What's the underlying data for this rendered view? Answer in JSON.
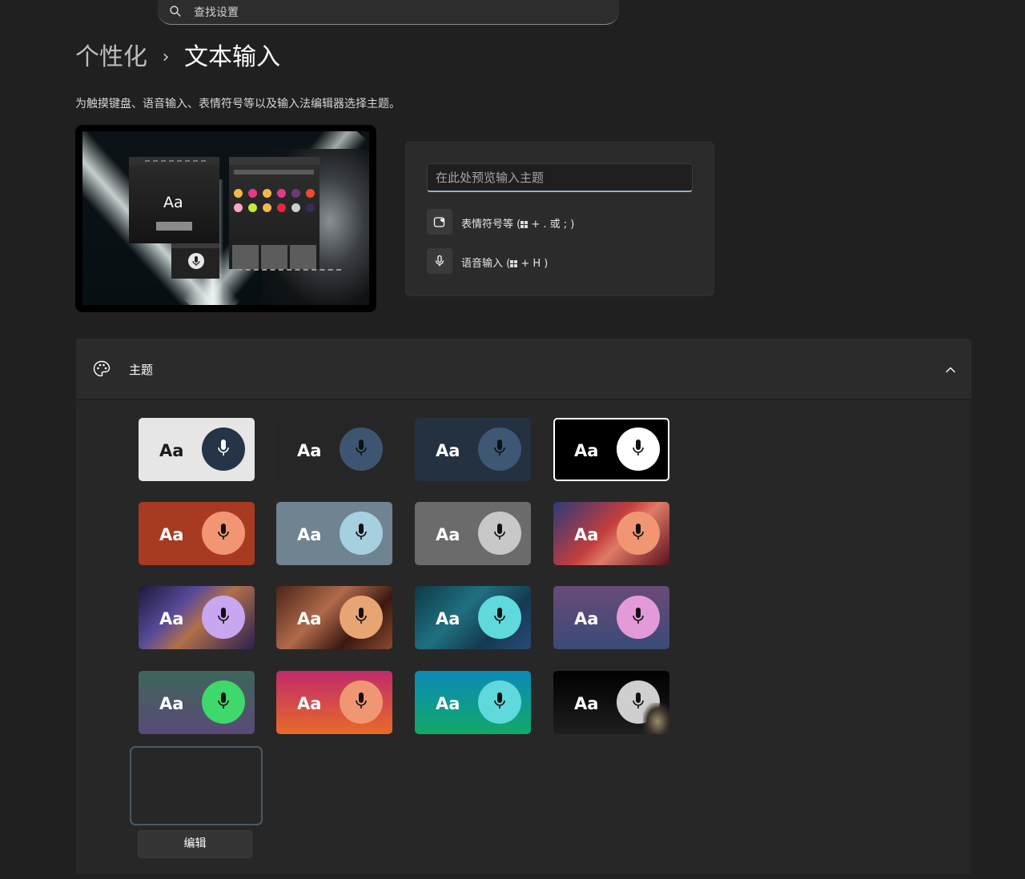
{
  "search": {
    "placeholder": "查找设置",
    "icon": "search-icon"
  },
  "breadcrumb": {
    "parent": "个性化",
    "separator": "›",
    "current": "文本输入"
  },
  "description": "为触摸键盘、语音输入、表情符号等以及输入法编辑器选择主题。",
  "tablet_preview": {
    "sample_text": "Aa"
  },
  "preview_box": {
    "input_placeholder": "在此处预览输入主题",
    "emoji_label_pre": "表情符号等 (",
    "emoji_label_post": " + . 或 ; )",
    "voice_label_pre": "语音输入 (",
    "voice_label_post": " + H )",
    "emoji_icon": "emoji-heart-icon",
    "voice_icon": "microphone-icon"
  },
  "themes": {
    "title": "主题",
    "icon": "palette-icon",
    "expanded": true,
    "tile_text": "Aa",
    "items": [
      {
        "bg": "#e6e6e6",
        "text": "#1a1a1a",
        "circle": "#253447",
        "mic": "#ffffff"
      },
      {
        "bg": "#262626",
        "text": "#ffffff",
        "circle": "#3e5572",
        "mic": "#111111"
      },
      {
        "bg": "#243140",
        "text": "#ffffff",
        "circle": "#3d5774",
        "mic": "#111111"
      },
      {
        "bg": "#000000",
        "text": "#ffffff",
        "circle": "#ffffff",
        "mic": "#111111",
        "border": "#ffffff"
      },
      {
        "bg": "#a83a22",
        "text": "#ffffff",
        "circle": "#f09673",
        "mic": "#111111"
      },
      {
        "bg": "#6f8390",
        "text": "#ffffff",
        "circle": "#a6cfe0",
        "mic": "#111111"
      },
      {
        "bg": "#6b6b6b",
        "text": "#ffffff",
        "circle": "#c8c8c8",
        "mic": "#111111"
      },
      {
        "bg": "linear-gradient(135deg,#2a3c7a 0%,#c33d3d 45%,#e07b66 60%,#5a1020 100%)",
        "text": "#ffffff",
        "circle": "#f09673",
        "mic": "#111111"
      },
      {
        "bg": "linear-gradient(135deg,#1a1a3a 0%,#5a4a9a 35%,#b0704a 55%,#2a2050 100%)",
        "text": "#ffffff",
        "circle": "#c9a6f0",
        "mic": "#111111"
      },
      {
        "bg": "linear-gradient(135deg,#4a2418 0%,#b06a4a 40%,#3a1810 70%,#8a4a30 100%)",
        "text": "#ffffff",
        "circle": "#e8a574",
        "mic": "#111111"
      },
      {
        "bg": "linear-gradient(135deg,#0d3a48 0%,#1f7080 40%,#143a50 70%,#2a4a7a 100%)",
        "text": "#ffffff",
        "circle": "#5fd9dc",
        "mic": "#111111"
      },
      {
        "bg": "linear-gradient(180deg,#6a4a78 0%,#3a4a78 100%)",
        "text": "#ffffff",
        "circle": "#e39ad8",
        "mic": "#111111"
      },
      {
        "bg": "linear-gradient(180deg,#3d6658 0%,#5a4a78 100%)",
        "text": "#ffffff",
        "circle": "#3fd86a",
        "mic": "#111111"
      },
      {
        "bg": "linear-gradient(180deg,#c02a6a 0%,#e86a2a 100%)",
        "text": "#ffffff",
        "circle": "#f09673",
        "mic": "#111111"
      },
      {
        "bg": "linear-gradient(180deg,#0a8ab8 0%,#13a868 100%)",
        "text": "#ffffff",
        "circle": "#5fd9dc",
        "mic": "#111111"
      },
      {
        "bg": "linear-gradient(180deg,#000000 0%,#1e1e1e 100%)",
        "text": "#ffffff",
        "circle": "#cfcfcf",
        "mic": "#111111",
        "selected": true
      }
    ],
    "edit_label": "编辑"
  }
}
